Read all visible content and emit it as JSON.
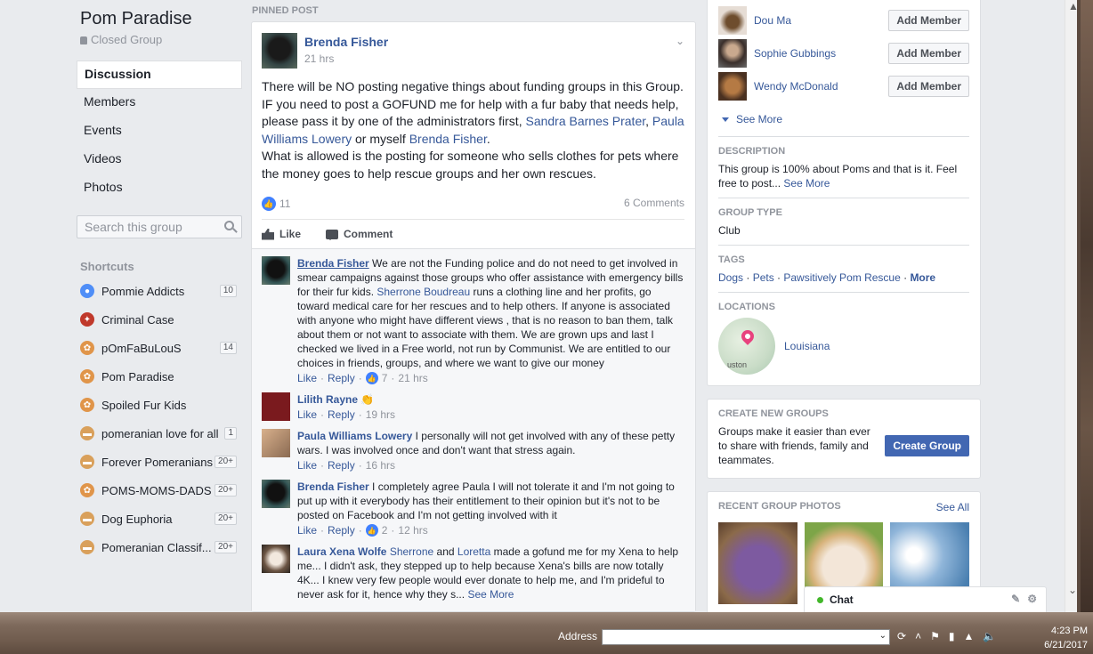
{
  "group": {
    "name": "Pom Paradise",
    "privacy": "Closed Group"
  },
  "nav": [
    "Discussion",
    "Members",
    "Events",
    "Videos",
    "Photos"
  ],
  "search": {
    "placeholder": "Search this group"
  },
  "shortcuts": {
    "title": "Shortcuts",
    "items": [
      {
        "label": "Pommie Addicts",
        "badge": "10",
        "icon": "group-people-icon",
        "color": "#4f8ef7"
      },
      {
        "label": "Criminal Case",
        "badge": "",
        "icon": "game-icon",
        "color": "#c0392b"
      },
      {
        "label": "pOmFaBuLouS",
        "badge": "14",
        "icon": "paw-icon",
        "color": "#e0954a"
      },
      {
        "label": "Pom Paradise",
        "badge": "",
        "icon": "paw-icon",
        "color": "#e0954a"
      },
      {
        "label": "Spoiled Fur Kids",
        "badge": "",
        "icon": "paw-icon",
        "color": "#e0954a"
      },
      {
        "label": "pomeranian love for all",
        "badge": "1",
        "icon": "bone-icon",
        "color": "#d9a05b"
      },
      {
        "label": "Forever Pomeranians",
        "badge": "20+",
        "icon": "bone-icon",
        "color": "#d9a05b"
      },
      {
        "label": "POMS-MOMS-DADS",
        "badge": "20+",
        "icon": "paw-icon",
        "color": "#e0954a"
      },
      {
        "label": "Dog Euphoria",
        "badge": "20+",
        "icon": "bone-icon",
        "color": "#d9a05b"
      },
      {
        "label": "Pomeranian Classif...",
        "badge": "20+",
        "icon": "bone-icon",
        "color": "#d9a05b"
      }
    ]
  },
  "post": {
    "pinned_label": "PINNED POST",
    "author": "Brenda Fisher",
    "time": "21 hrs",
    "body": {
      "p1": "There will be NO posting negative things about funding groups in this Group. IF you need to post a GOFUND me for help with a fur baby that needs help, please pass it by one of the administrators first, ",
      "link1": "Sandra Barnes Prater",
      "sep": ", ",
      "link2": "Paula Williams Lowery",
      "p2": " or myself ",
      "link3": "Brenda Fisher",
      "p3": ".",
      "p4": "What is allowed is the posting for someone who sells clothes for pets where the money goes to help rescue groups and her own rescues."
    },
    "likes": "11",
    "comments_count": "6 Comments",
    "like_label": "Like",
    "comment_label": "Comment"
  },
  "comments": [
    {
      "author": "Brenda Fisher",
      "text_a": " We are not the Funding police and do not need to get involved in smear campaigns against those groups who offer assistance with emergency bills for their fur kids. ",
      "mention": "Sherrone Boudreau",
      "text_b": " runs a clothing line and her profits, go toward medical care for her rescues and to help others. If anyone is associated with anyone who might have different views , that is no reason to ban them, talk about them or not want to associate with them. We are grown ups and last I checked we lived in a Free world, not run by Communist. We are entitled to our choices in friends, groups, and where we want to give our money",
      "like": "Like",
      "reply": "Reply",
      "reactions": "7",
      "time": "21 hrs"
    },
    {
      "author": "Lilith Rayne",
      "text_a": " 👏",
      "like": "Like",
      "reply": "Reply",
      "time": "19 hrs"
    },
    {
      "author": "Paula Williams Lowery",
      "text_a": " I personally will not get involved with any of these petty wars. I was involved once and don't want that stress again.",
      "like": "Like",
      "reply": "Reply",
      "time": "16 hrs"
    },
    {
      "author": "Brenda Fisher",
      "text_a": " I completely agree Paula I will not tolerate it and I'm not going to put up with it everybody has their entitlement to their opinion but it's not to be posted on Facebook and I'm not getting involved with it",
      "like": "Like",
      "reply": "Reply",
      "reactions": "2",
      "time": "12 hrs"
    },
    {
      "author": "Laura Xena Wolfe",
      "mention": "Sherrone",
      "mid": " and ",
      "mention2": "Loretta",
      "text_a": " made a gofund me for my Xena to help me... I didn't ask, they stepped up to help because Xena's bills are now totally 4K... I knew very few people would ever donate to help me, and I'm prideful to never ask for it, hence why they s...",
      "see_more": "See More"
    }
  ],
  "members": [
    {
      "name": "Dou Ma",
      "button": "Add Member"
    },
    {
      "name": "Sophie Gubbings",
      "button": "Add Member"
    },
    {
      "name": "Wendy McDonald",
      "button": "Add Member"
    }
  ],
  "see_more": "See More",
  "description": {
    "title": "DESCRIPTION",
    "text": "This group is 100% about Poms and that is it. Feel free to post...",
    "see_more": "See More"
  },
  "group_type": {
    "title": "GROUP TYPE",
    "value": "Club"
  },
  "tags": {
    "title": "TAGS",
    "items": [
      "Dogs",
      "Pets",
      "Pawsitively Pom Rescue"
    ],
    "more": "More"
  },
  "locations": {
    "title": "LOCATIONS",
    "place": "Louisiana",
    "map_text": "uston"
  },
  "create_groups": {
    "title": "CREATE NEW GROUPS",
    "text": "Groups make it easier than ever to share with friends, family and teammates.",
    "button": "Create Group"
  },
  "recent_photos": {
    "title": "RECENT GROUP PHOTOS",
    "see_all": "See All"
  },
  "chat": {
    "label": "Chat"
  },
  "taskbar": {
    "address_label": "Address",
    "time": "4:23 PM",
    "date": "6/21/2017"
  },
  "colors": {
    "fb_blue": "#4267b2",
    "link": "#365899",
    "bg": "#e9ebee"
  }
}
